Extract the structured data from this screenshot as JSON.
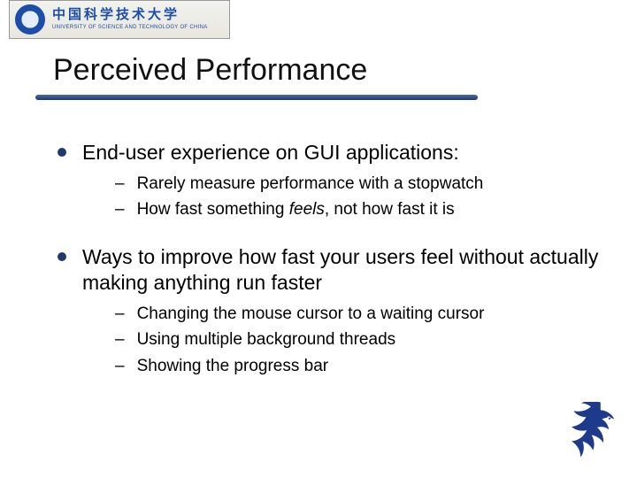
{
  "logo": {
    "cn": "中国科学技术大学",
    "en": "UNIVERSITY OF SCIENCE AND TECHNOLOGY OF CHINA"
  },
  "title": "Perceived Performance",
  "bullets": [
    {
      "text": "End-user experience on GUI applications:",
      "sub": [
        "Rarely measure performance with a stopwatch",
        "How fast something feels, not how fast it is"
      ]
    },
    {
      "text": "Ways to improve how fast your users feel without actually making anything run faster",
      "sub": [
        "Changing the mouse cursor to a waiting cursor",
        "Using multiple background threads",
        "Showing the progress bar"
      ]
    }
  ],
  "feels_word": "feels"
}
